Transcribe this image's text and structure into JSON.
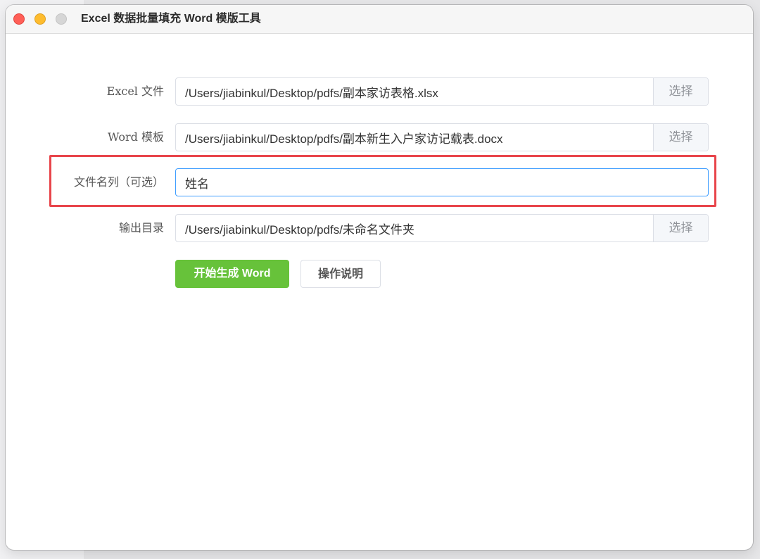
{
  "window": {
    "title": "Excel 数据批量填充 Word 模版工具"
  },
  "form": {
    "excel_file": {
      "label": "Excel 文件",
      "value": "/Users/jiabinkul/Desktop/pdfs/副本家访表格.xlsx",
      "button": "选择"
    },
    "word_template": {
      "label": "Word 模板",
      "value": "/Users/jiabinkul/Desktop/pdfs/副本新生入户家访记载表.docx",
      "button": "选择"
    },
    "filename_column": {
      "label": "文件名列（可选）",
      "value": "姓名"
    },
    "output_dir": {
      "label": "输出目录",
      "value": "/Users/jiabinkul/Desktop/pdfs/未命名文件夹",
      "button": "选择"
    }
  },
  "actions": {
    "generate_label": "开始生成 Word",
    "help_label": "操作说明"
  },
  "colors": {
    "primary": "#67c23a",
    "focus_border": "#409eff",
    "highlight": "#e8454b"
  }
}
